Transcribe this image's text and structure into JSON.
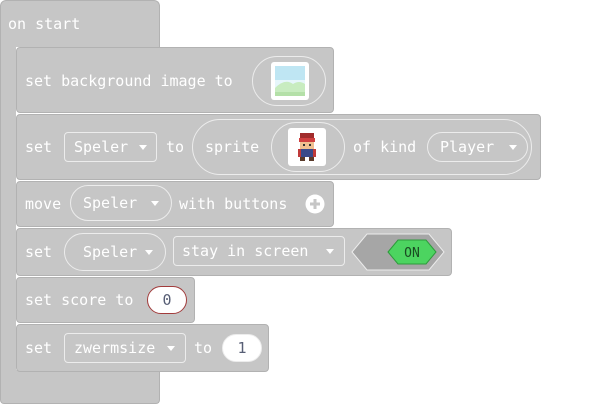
{
  "hat": {
    "label": "on start"
  },
  "row1": {
    "set": "set background image to"
  },
  "row2": {
    "set": "set",
    "var": "Speler",
    "to": "to",
    "sprite": "sprite",
    "of_kind": "of kind",
    "kind": "Player"
  },
  "row3": {
    "move": "move",
    "var": "Speler",
    "with_buttons": "with buttons",
    "plus_icon": "plus-circle-icon"
  },
  "row4": {
    "set": "set",
    "var": "Speler",
    "property": "stay in screen",
    "toggle": "ON",
    "toggle_color": "#4cd460"
  },
  "row5": {
    "label": "set score to",
    "value": "0"
  },
  "row6": {
    "set": "set",
    "var": "zwermsize",
    "to": "to",
    "value": "1"
  },
  "colors": {
    "block": "#c6c6c6",
    "border": "#b2b2b2",
    "text": "#ffffff",
    "value_text": "#575e75",
    "score_border": "#a23c3c"
  }
}
